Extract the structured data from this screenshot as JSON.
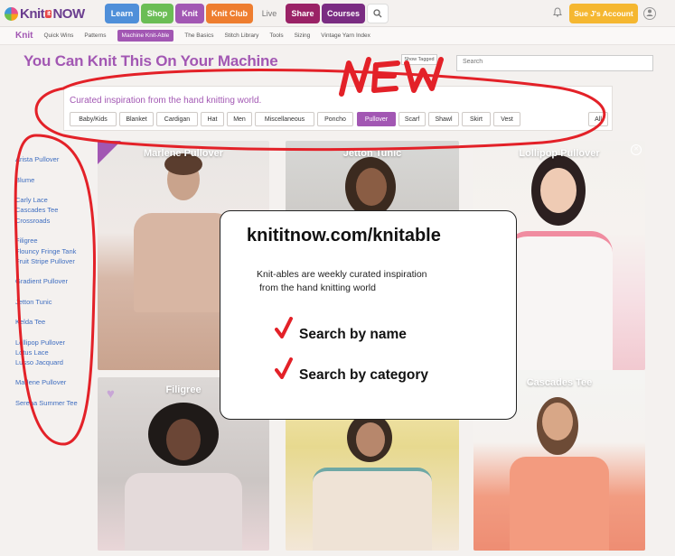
{
  "nav": {
    "logo": {
      "part1": "Knit",
      "part2": "it",
      "part3": "NOW"
    },
    "items": [
      {
        "label": "Learn",
        "color": "#4f8fd9"
      },
      {
        "label": "Shop",
        "color": "#6bbd55"
      },
      {
        "label": "Knit",
        "color": "#a257b3"
      },
      {
        "label": "Knit Club",
        "color": "#ee7d2f"
      },
      {
        "label": "Live",
        "color": "#f4f1ef"
      },
      {
        "label": "Share",
        "color": "#9a2266"
      },
      {
        "label": "Courses",
        "color": "#7a2c82"
      }
    ],
    "search_icon": "search-icon",
    "bell_icon": "bell-icon",
    "account_label": "Sue J's Account",
    "user_icon": "user-icon"
  },
  "subnav": {
    "brand": "Knit",
    "items": [
      "Quick Wins",
      "Patterns",
      "Machine Knit-Able",
      "The Basics",
      "Stitch Library",
      "Tools",
      "Sizing",
      "Vintage Yarn Index"
    ],
    "active": "Machine Knit-Able"
  },
  "page": {
    "title": "You Can Knit This On Your Machine",
    "show_tagged": "Show Tagged",
    "search_placeholder": "Search"
  },
  "categories": {
    "subtitle": "Curated inspiration from the hand knitting world.",
    "items": [
      "Baby/Kids",
      "Blanket",
      "Cardigan",
      "Hat",
      "Men",
      "Miscellaneous",
      "Poncho",
      "Pullover",
      "Scarf",
      "Shawl",
      "Skirt",
      "Vest",
      "All"
    ],
    "active": "Pullover"
  },
  "sidebar": {
    "items": [
      "Arista Pullover",
      "Blume",
      "Carly Lace",
      "Cascades Tee",
      "Crossroads",
      "Filigree",
      "Flouncy Fringe Tank",
      "Fruit Stripe Pullover",
      "Gradient Pullover",
      "Jetton Tunic",
      "Kelda Tee",
      "Lollipop Pullover",
      "Lotus Lace",
      "Lusso Jacquard",
      "Marlene Pullover",
      "Serena Summer Tee"
    ]
  },
  "cards": [
    {
      "title": "Marlene Pullover"
    },
    {
      "title": "Jetton Tunic"
    },
    {
      "title": "Lollipop Pullover"
    },
    {
      "title": "Filigree"
    },
    {
      "title": ""
    },
    {
      "title": "Cascades Tee"
    }
  ],
  "popup": {
    "url": "knititnow.com/knitable",
    "desc_line1": "Knit-ables are weekly curated inspiration",
    "desc_line2": "from the hand knitting world",
    "feature1": "Search by name",
    "feature2": "Search by category"
  },
  "annotation": {
    "new_label": "NEW",
    "color": "#e32128"
  }
}
